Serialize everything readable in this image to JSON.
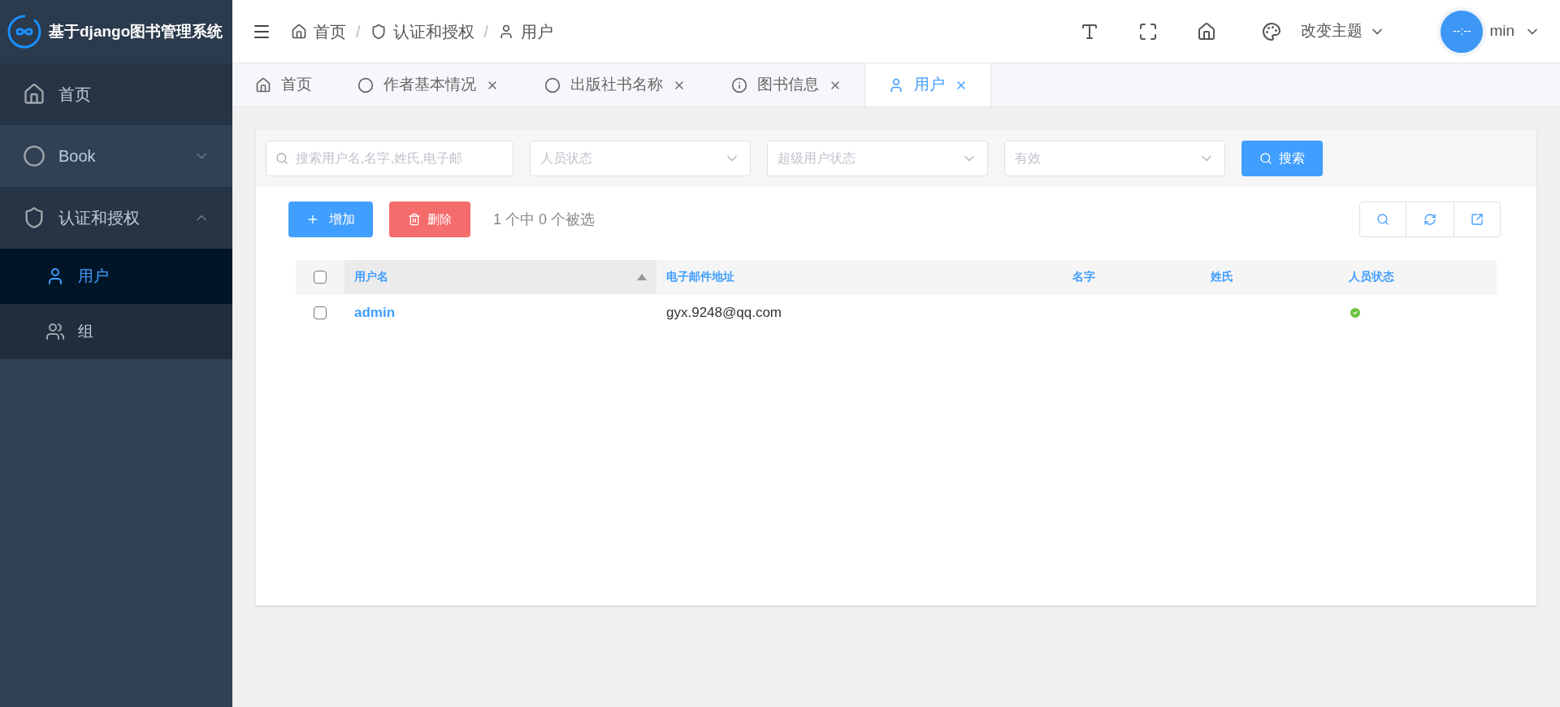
{
  "sidebar": {
    "logo_title": "基于django图书管理系统",
    "items": [
      {
        "label": "首页",
        "kind": "home",
        "selected": false
      },
      {
        "label": "Book",
        "kind": "circle",
        "expanded": false,
        "selected": false
      },
      {
        "label": "认证和授权",
        "kind": "shield",
        "expanded": true,
        "selected": false,
        "children": [
          {
            "label": "用户",
            "kind": "user",
            "selected": true
          },
          {
            "label": "组",
            "kind": "users",
            "selected": false
          }
        ]
      }
    ]
  },
  "header": {
    "separator": "/",
    "breadcrumb": [
      {
        "label": "首页",
        "kind": "home"
      },
      {
        "label": "认证和授权",
        "kind": "shield"
      },
      {
        "label": "用户",
        "kind": "user"
      }
    ],
    "theme_label": "改变主题",
    "avatar_text": "--:--",
    "username": "min"
  },
  "tabs": [
    {
      "label": "首页",
      "kind": "home",
      "closable": false,
      "selected": false
    },
    {
      "label": "作者基本情况",
      "kind": "circle",
      "closable": true,
      "selected": false
    },
    {
      "label": "出版社书名称",
      "kind": "circle",
      "closable": true,
      "selected": false
    },
    {
      "label": "图书信息",
      "kind": "info",
      "closable": true,
      "selected": false
    },
    {
      "label": "用户",
      "kind": "user",
      "closable": true,
      "selected": true
    }
  ],
  "filters": {
    "search_placeholder": "搜索用户名,名字,姓氏,电子邮",
    "selects": [
      {
        "placeholder": "人员状态"
      },
      {
        "placeholder": "超级用户状态"
      },
      {
        "placeholder": "有效"
      }
    ],
    "search_button": "搜索"
  },
  "actions": {
    "add": "增加",
    "delete": "删除",
    "selection_info": "1 个中 0 个被选"
  },
  "table": {
    "all_checked": false,
    "columns": [
      {
        "label": "用户名",
        "sorted": true
      },
      {
        "label": "电子邮件地址",
        "sorted": false
      },
      {
        "label": "名字",
        "sorted": false
      },
      {
        "label": "姓氏",
        "sorted": false
      },
      {
        "label": "人员状态",
        "sorted": false
      }
    ],
    "rows": [
      {
        "checked": false,
        "username": "admin",
        "email": "gyx.9248@qq.com",
        "active": true
      }
    ]
  }
}
